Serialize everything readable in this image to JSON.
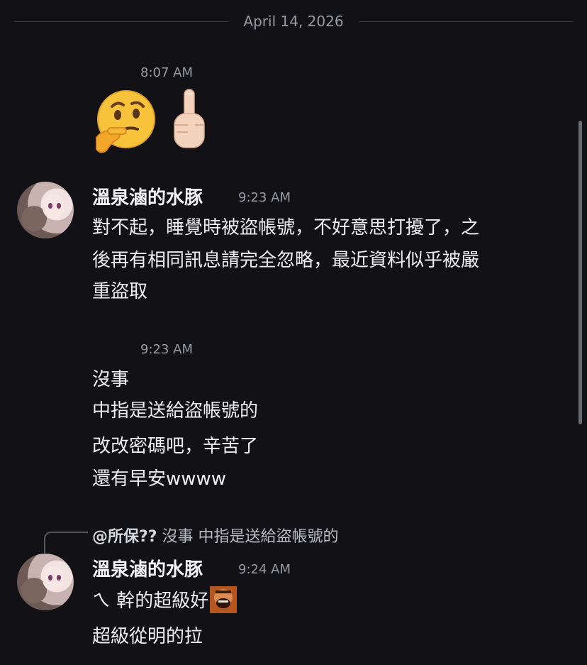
{
  "date_separator": "April 14, 2026",
  "messages": [
    {
      "timestamp": "8:07 AM",
      "emojis": [
        "thinking-face",
        "middle-finger"
      ]
    },
    {
      "username": "溫泉滷的水豚",
      "timestamp": "9:23 AM",
      "lines": [
        "對不起，睡覺時被盜帳號，不好意思打擾了，之",
        "後再有相同訊息請完全忽略，最近資料似乎被嚴",
        "重盜取"
      ]
    },
    {
      "timestamp": "9:23 AM",
      "lines": [
        "沒事",
        "中指是送給盜帳號的",
        "改改密碼吧，辛苦了",
        "還有早安wwww"
      ]
    },
    {
      "reply": {
        "author": "@所保??",
        "text": "沒事 中指是送給盜帳號的"
      },
      "username": "溫泉滷的水豚",
      "timestamp": "9:24 AM",
      "lines": [
        "ㄟ 幹的超級好",
        "超級從明的拉"
      ]
    }
  ],
  "colors": {
    "background": "#121216",
    "text": "#eeeef2",
    "muted": "#9a9aa3"
  }
}
